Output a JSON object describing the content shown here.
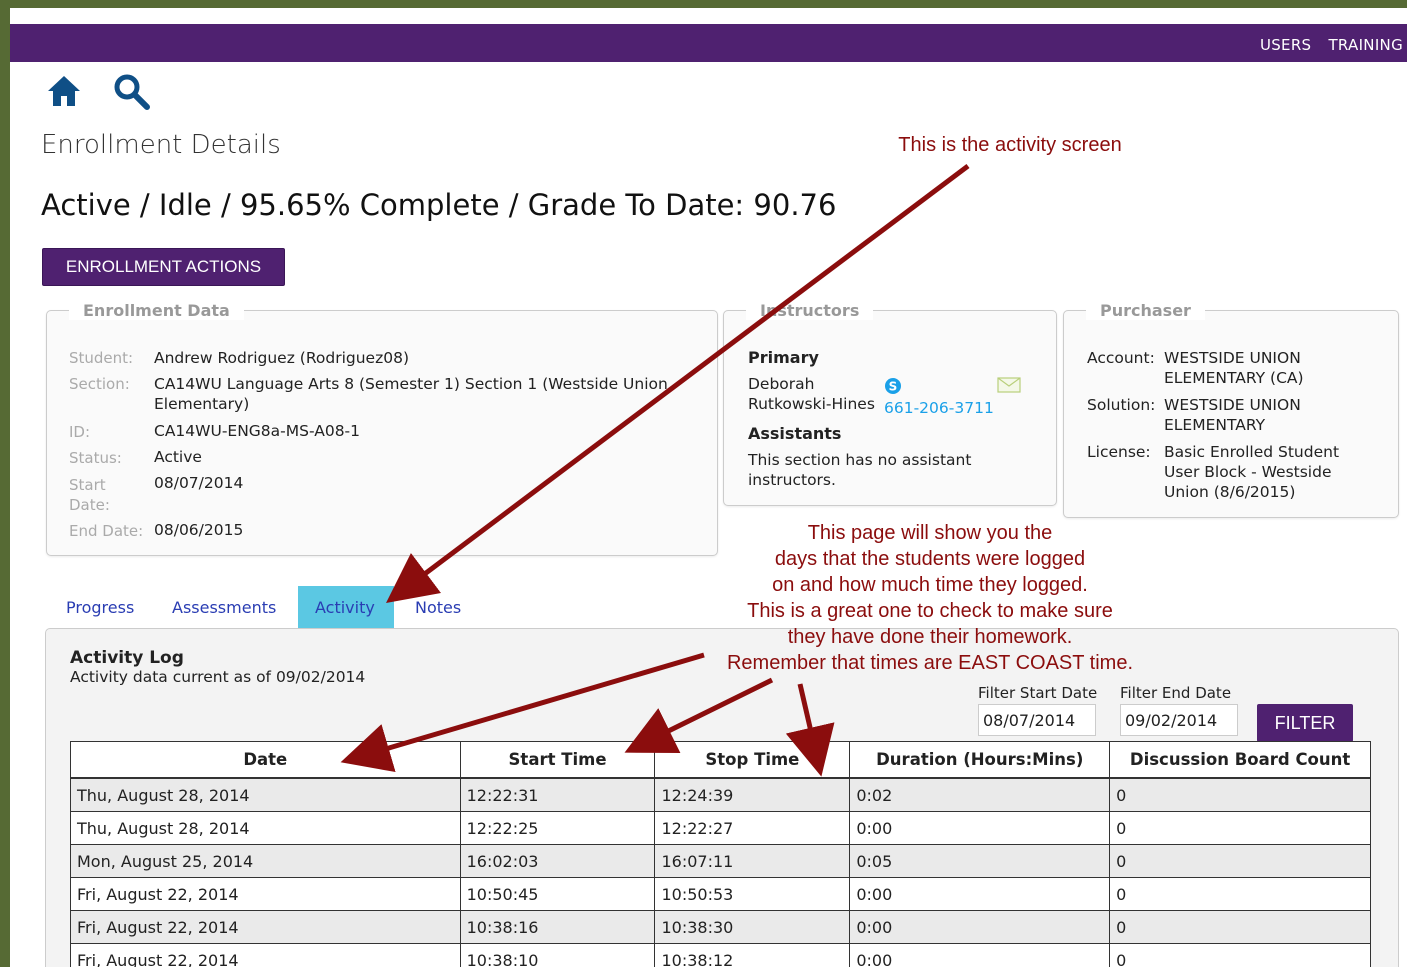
{
  "topnav": {
    "users": "USERS",
    "training": "TRAINING"
  },
  "header": {
    "title": "Enrollment Details",
    "status": "Active / Idle / 95.65% Complete / Grade To Date: 90.76",
    "enrollment_actions": "ENROLLMENT ACTIONS"
  },
  "enrollment_data": {
    "legend": "Enrollment Data",
    "student_label": "Student:",
    "student": "Andrew Rodriguez (Rodriguez08)",
    "section_label": "Section:",
    "section": "CA14WU Language Arts 8 (Semester 1) Section 1 (Westside Union Elementary)",
    "id_label": "ID:",
    "id": "CA14WU-ENG8a-MS-A08-1",
    "status_label": "Status:",
    "status": "Active",
    "start_label": "Start Date:",
    "start": "08/07/2014",
    "end_label": "End Date:",
    "end": "08/06/2015"
  },
  "instructors": {
    "legend": "Instructors",
    "primary_heading": "Primary",
    "primary_name": "Deborah Rutkowski-Hines",
    "phone": "661-206-3711",
    "assistants_heading": "Assistants",
    "assistants_text": "This section has no assistant instructors."
  },
  "purchaser": {
    "legend": "Purchaser",
    "account_label": "Account:",
    "account": "WESTSIDE UNION ELEMENTARY (CA)",
    "solution_label": "Solution:",
    "solution": "WESTSIDE UNION ELEMENTARY",
    "license_label": "License:",
    "license": "Basic Enrolled Student User Block - Westside Union (8/6/2015)"
  },
  "tabs": [
    "Progress",
    "Assessments",
    "Activity",
    "Notes"
  ],
  "activity_log": {
    "title": "Activity Log",
    "subtitle": "Activity data current as of 09/02/2014",
    "filter_start_label": "Filter Start Date",
    "filter_start_value": "08/07/2014",
    "filter_end_label": "Filter End Date",
    "filter_end_value": "09/02/2014",
    "filter_button": "FILTER",
    "columns": [
      "Date",
      "Start Time",
      "Stop Time",
      "Duration (Hours:Mins)",
      "Discussion Board Count"
    ],
    "rows": [
      [
        "Thu, August 28, 2014",
        "12:22:31",
        "12:24:39",
        "0:02",
        "0"
      ],
      [
        "Thu, August 28, 2014",
        "12:22:25",
        "12:22:27",
        "0:00",
        "0"
      ],
      [
        "Mon, August 25, 2014",
        "16:02:03",
        "16:07:11",
        "0:05",
        "0"
      ],
      [
        "Fri, August 22, 2014",
        "10:50:45",
        "10:50:53",
        "0:00",
        "0"
      ],
      [
        "Fri, August 22, 2014",
        "10:38:16",
        "10:38:30",
        "0:00",
        "0"
      ],
      [
        "Fri, August 22, 2014",
        "10:38:10",
        "10:38:12",
        "0:00",
        "0"
      ]
    ]
  },
  "annotations": {
    "top": "This is the activity screen",
    "middle": [
      "This page will show you the",
      "days that the students were logged",
      "on and how much time they logged.",
      "This is a great one to check to make sure",
      "they have done their homework.",
      "Remember that times are EAST COAST time."
    ]
  },
  "colors": {
    "brand_purple": "#4f2170",
    "active_tab": "#5bc8e3",
    "annotation_red": "#8b0d0d",
    "link_blue": "#2a3db3"
  }
}
